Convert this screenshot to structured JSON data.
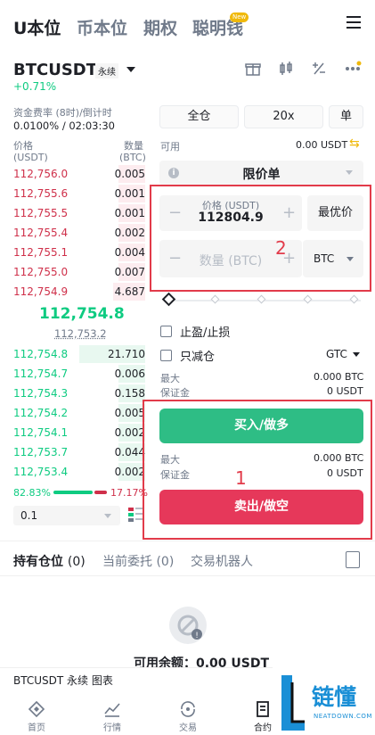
{
  "top_tabs": [
    {
      "label": "U本位",
      "active": true
    },
    {
      "label": "币本位",
      "active": false
    },
    {
      "label": "期权",
      "active": false
    },
    {
      "label": "聪明钱",
      "active": false
    }
  ],
  "new_badge": "New",
  "header": {
    "symbol": "BTCUSDT",
    "contract_type": "永续",
    "change_pct": "+0.71%"
  },
  "funding": {
    "label": "资金费率 (8时)/倒计时",
    "value": "0.0100% / 02:03:30"
  },
  "orderbook": {
    "price_header": "价格",
    "price_unit": "(USDT)",
    "qty_header": "数量",
    "qty_unit": "(BTC)",
    "asks": [
      {
        "price": "112,756.0",
        "qty": "0.005",
        "depth": 0.2
      },
      {
        "price": "112,755.6",
        "qty": "0.001",
        "depth": 0.2
      },
      {
        "price": "112,755.5",
        "qty": "0.001",
        "depth": 0.2
      },
      {
        "price": "112,755.4",
        "qty": "0.002",
        "depth": 0.2
      },
      {
        "price": "112,755.1",
        "qty": "0.004",
        "depth": 0.2
      },
      {
        "price": "112,755.0",
        "qty": "0.007",
        "depth": 0.2
      },
      {
        "price": "112,754.9",
        "qty": "4.687",
        "depth": 0.24
      }
    ],
    "mid_price": "112,754.8",
    "mark_price": "112,753.2",
    "bids": [
      {
        "price": "112,754.8",
        "qty": "21.710",
        "depth": 0.5
      },
      {
        "price": "112,754.7",
        "qty": "0.006",
        "depth": 0.2
      },
      {
        "price": "112,754.3",
        "qty": "0.158",
        "depth": 0.2
      },
      {
        "price": "112,754.2",
        "qty": "0.005",
        "depth": 0.2
      },
      {
        "price": "112,754.1",
        "qty": "0.002",
        "depth": 0.2
      },
      {
        "price": "112,753.7",
        "qty": "0.044",
        "depth": 0.2
      },
      {
        "price": "112,753.4",
        "qty": "0.002",
        "depth": 0.2
      }
    ],
    "buy_ratio": "82.83%",
    "sell_ratio": "17.17%",
    "depth_step": "0.1"
  },
  "order_form": {
    "margin_mode": "全仓",
    "leverage": "20x",
    "position_mode": "单",
    "available_label": "可用",
    "available_value": "0.00 USDT",
    "order_type": "限价单",
    "price_label": "价格 (USDT)",
    "price_value": "112804.9",
    "best_price_label": "最优价",
    "qty_placeholder": "数量 (BTC)",
    "qty_unit": "BTC",
    "tp_sl_label": "止盈/止损",
    "reduce_only_label": "只减仓",
    "tif": "GTC",
    "buy_max_label": "最大",
    "buy_max_value": "0.000 BTC",
    "buy_margin_label": "保证金",
    "buy_margin_value": "0 USDT",
    "buy_button": "买入/做多",
    "sell_max_label": "最大",
    "sell_max_value": "0.000 BTC",
    "sell_margin_label": "保证金",
    "sell_margin_value": "0 USDT",
    "sell_button": "卖出/做空"
  },
  "annotations": {
    "box_1_label": "1",
    "box_2_label": "2",
    "box_color": "#e23b4a"
  },
  "positions": {
    "tabs": [
      {
        "label": "持有仓位",
        "count": "(0)",
        "active": true
      },
      {
        "label": "当前委托",
        "count": "(0)",
        "active": false
      },
      {
        "label": "交易机器人",
        "count": "",
        "active": false
      }
    ],
    "empty_text": "可用余额：0.00 USDT"
  },
  "chart_bar": {
    "label": "BTCUSDT 永续 图表"
  },
  "bottom_nav": [
    {
      "label": "首页",
      "icon": "home-diamond-icon"
    },
    {
      "label": "行情",
      "icon": "market-chart-icon"
    },
    {
      "label": "交易",
      "icon": "trade-swap-icon"
    },
    {
      "label": "合约",
      "icon": "futures-icon"
    }
  ],
  "watermark": {
    "cn": "链懂",
    "en": "NEATDOWN.COM"
  },
  "colors": {
    "green": "#0ecb81",
    "red": "#cf304a",
    "buy_button": "#2ebd85",
    "sell_button": "#e6385a",
    "accent": "#f0b90b"
  }
}
